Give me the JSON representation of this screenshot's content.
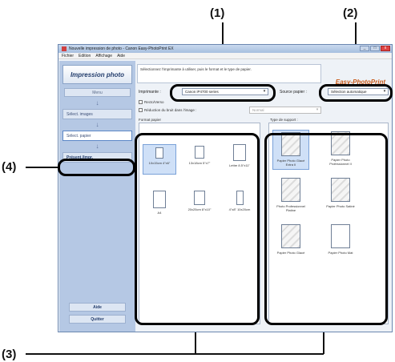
{
  "callouts": {
    "c1": "(1)",
    "c2": "(2)",
    "c3": "(3)",
    "c4": "(4)"
  },
  "window": {
    "title": "Nouvelle impression de photo - Canon Easy-PhotoPrint EX",
    "menu": [
      "Fichier",
      "Edition",
      "Affichage",
      "Aide"
    ],
    "controls": {
      "minimize": "_",
      "maximize": "□",
      "close": "x"
    }
  },
  "sidebar": {
    "header": "Impression photo",
    "steps": [
      "Menu",
      "Sélect. images",
      "Sélect. papier",
      "Présent./Impr."
    ],
    "arrow": "↓",
    "help": "Aide",
    "quit": "Quitter"
  },
  "main": {
    "instruction": "Sélectionnez l'imprimante à utiliser, puis le format et le type de papier.",
    "logo": "Easy-PhotoPrint",
    "printer_label": "Imprimante :",
    "printer_value": "Canon iP4700 series",
    "paper_source_label": "Source papier :",
    "paper_source_value": "Sélection automatique",
    "duplex_label": "Recto/Verso",
    "noise_label": "Réduction du bruit dans l'image :",
    "noise_value": "Normal",
    "paper_size_label": "Format papier",
    "media_type_label": "Type de support :"
  },
  "paper_sizes": [
    {
      "label": "10x15cm 4\"x6\""
    },
    {
      "label": "13x18cm 5\"x7\""
    },
    {
      "label": "Lettre 8.5\"x11\""
    },
    {
      "label": "A4"
    },
    {
      "label": "20x25cm 8\"x10\""
    },
    {
      "label": "4\"x8\" 10x20cm"
    }
  ],
  "media_types": [
    {
      "label": "Papier Photo Glacé Extra II"
    },
    {
      "label": "Papier Photo Professionnel II"
    },
    {
      "label": "Photo Professionnel Platine"
    },
    {
      "label": "Papier Photo Satiné"
    },
    {
      "label": "Papier Photo Glacé"
    },
    {
      "label": "Papier Photo Mat"
    }
  ]
}
